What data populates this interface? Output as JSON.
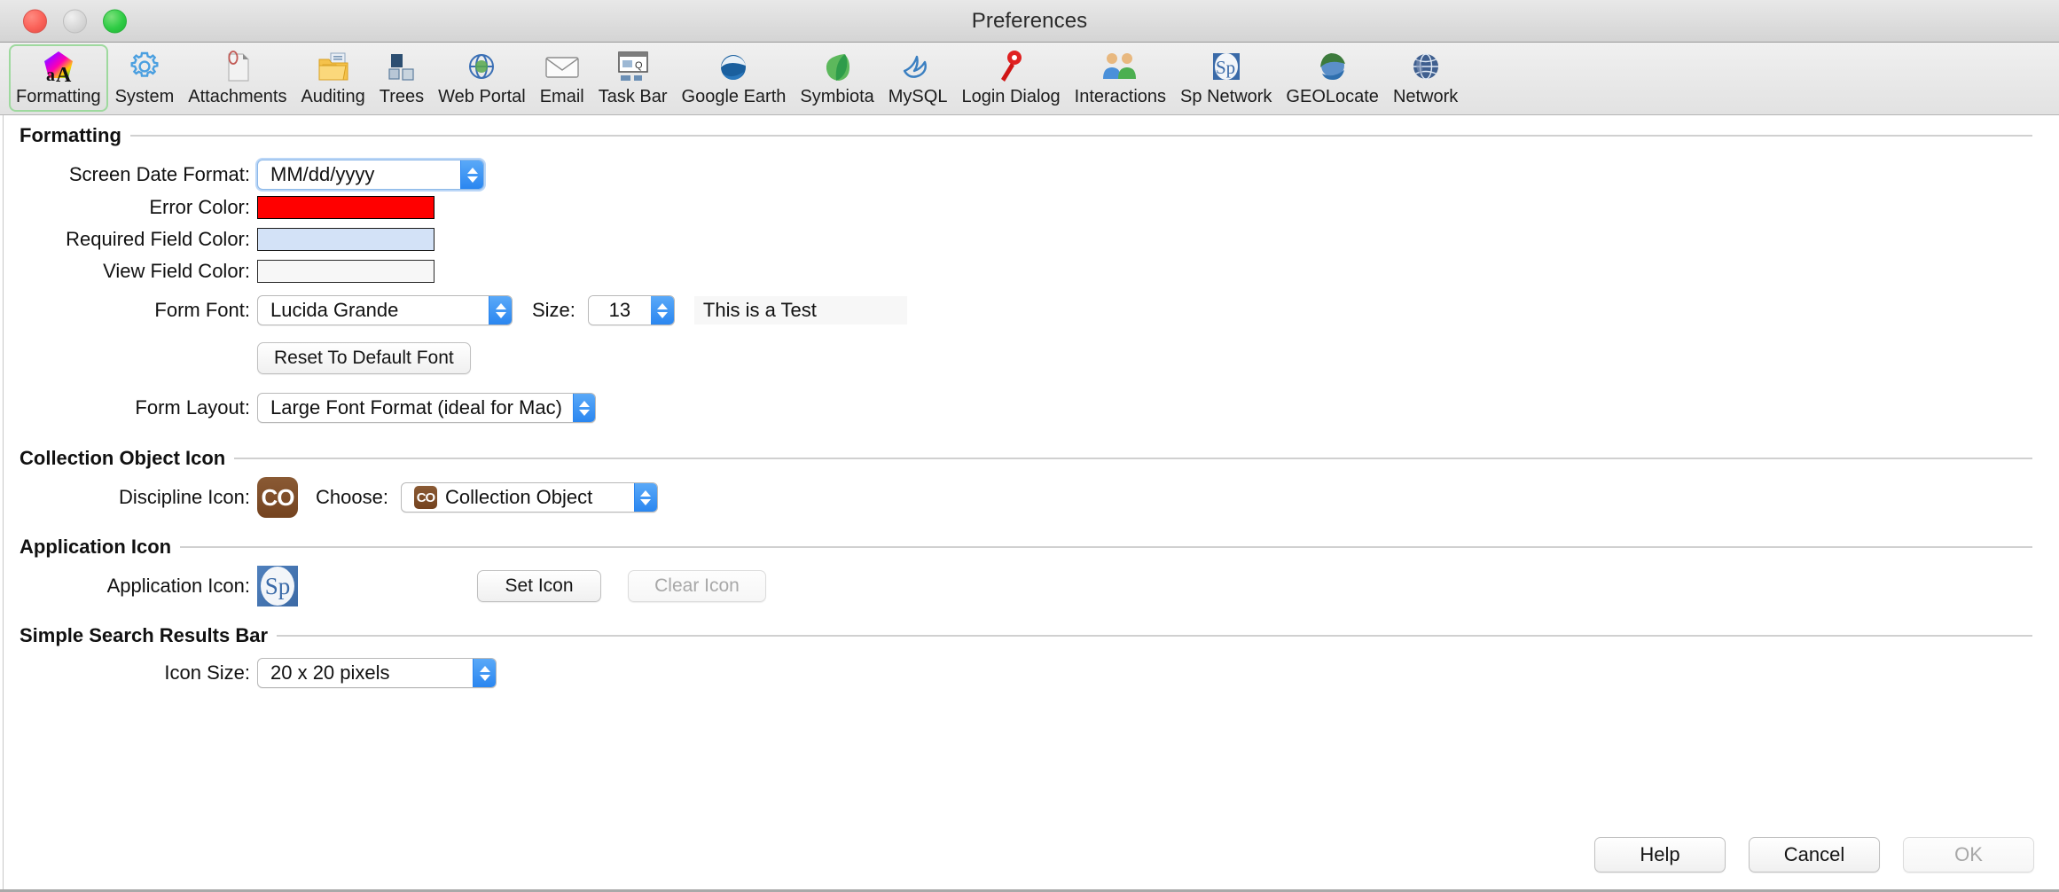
{
  "window": {
    "title": "Preferences",
    "traffic_lights": [
      "close",
      "minimize",
      "zoom"
    ]
  },
  "toolbar": {
    "selected": "Formatting",
    "items": [
      {
        "label": "Formatting",
        "icon": "color-font-icon"
      },
      {
        "label": "System",
        "icon": "gear-icon"
      },
      {
        "label": "Attachments",
        "icon": "paperclip-document-icon"
      },
      {
        "label": "Auditing",
        "icon": "folder-documents-icon"
      },
      {
        "label": "Trees",
        "icon": "nodes-icon"
      },
      {
        "label": "Web Portal",
        "icon": "globe-gear-icon"
      },
      {
        "label": "Email",
        "icon": "envelope-icon"
      },
      {
        "label": "Task Bar",
        "icon": "taskbar-icon"
      },
      {
        "label": "Google Earth",
        "icon": "google-earth-icon"
      },
      {
        "label": "Symbiota",
        "icon": "symbiota-leaf-icon"
      },
      {
        "label": "MySQL",
        "icon": "mysql-dolphin-icon"
      },
      {
        "label": "Login Dialog",
        "icon": "red-key-icon"
      },
      {
        "label": "Interactions",
        "icon": "people-icon"
      },
      {
        "label": "Sp Network",
        "icon": "sp-network-icon"
      },
      {
        "label": "GEOLocate",
        "icon": "geolocate-icon"
      },
      {
        "label": "Network",
        "icon": "network-globe-icon"
      }
    ]
  },
  "sections": {
    "formatting": {
      "title": "Formatting",
      "screen_date_format": {
        "label": "Screen Date Format:",
        "value": "MM/dd/yyyy"
      },
      "error_color": {
        "label": "Error Color:",
        "color": "#FF0000"
      },
      "required_field_color": {
        "label": "Required Field Color:",
        "color": "#D3E2F7"
      },
      "view_field_color": {
        "label": "View Field Color:",
        "color": "#F7F7F7"
      },
      "form_font": {
        "label": "Form Font:",
        "value": "Lucida Grande"
      },
      "size": {
        "label": "Size:",
        "value": "13"
      },
      "sample_text": "This is a Test",
      "reset_button": "Reset To Default Font",
      "form_layout": {
        "label": "Form Layout:",
        "value": "Large Font Format (ideal for Mac)"
      }
    },
    "collection_object_icon": {
      "title": "Collection Object Icon",
      "discipline_icon": {
        "label": "Discipline Icon:",
        "icon_text": "CO"
      },
      "choose": {
        "label": "Choose:",
        "value": "Collection Object",
        "icon_text": "CO"
      }
    },
    "application_icon": {
      "title": "Application Icon",
      "app_icon": {
        "label": "Application Icon:",
        "icon_text": "Sp"
      },
      "set_icon_button": "Set Icon",
      "clear_icon_button": "Clear Icon"
    },
    "simple_search_results_bar": {
      "title": "Simple Search Results Bar",
      "icon_size": {
        "label": "Icon Size:",
        "value": "20 x 20 pixels"
      }
    }
  },
  "footer": {
    "help": "Help",
    "cancel": "Cancel",
    "ok": "OK",
    "ok_disabled": true
  },
  "colors": {
    "accent_blue": "#2A86F0",
    "selection_green": "#9ED99E",
    "error_red": "#FF0000",
    "required_blue": "#D3E2F7",
    "co_brown": "#74431F",
    "sp_blue": "#4F80BD"
  }
}
